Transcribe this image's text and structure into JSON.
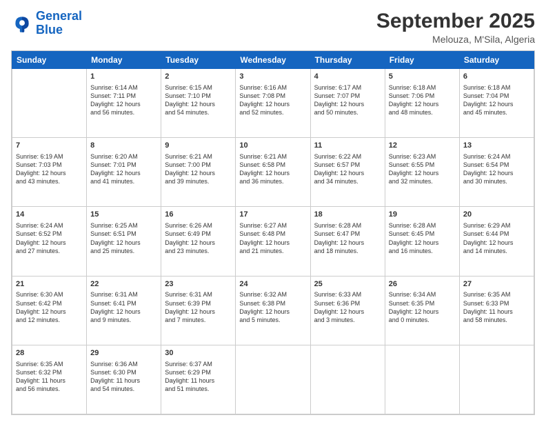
{
  "logo": {
    "text_general": "General",
    "text_blue": "Blue"
  },
  "header": {
    "month": "September 2025",
    "location": "Melouza, M'Sila, Algeria"
  },
  "days_of_week": [
    "Sunday",
    "Monday",
    "Tuesday",
    "Wednesday",
    "Thursday",
    "Friday",
    "Saturday"
  ],
  "weeks": [
    [
      {
        "day": "",
        "info": ""
      },
      {
        "day": "1",
        "info": "Sunrise: 6:14 AM\nSunset: 7:11 PM\nDaylight: 12 hours\nand 56 minutes."
      },
      {
        "day": "2",
        "info": "Sunrise: 6:15 AM\nSunset: 7:10 PM\nDaylight: 12 hours\nand 54 minutes."
      },
      {
        "day": "3",
        "info": "Sunrise: 6:16 AM\nSunset: 7:08 PM\nDaylight: 12 hours\nand 52 minutes."
      },
      {
        "day": "4",
        "info": "Sunrise: 6:17 AM\nSunset: 7:07 PM\nDaylight: 12 hours\nand 50 minutes."
      },
      {
        "day": "5",
        "info": "Sunrise: 6:18 AM\nSunset: 7:06 PM\nDaylight: 12 hours\nand 48 minutes."
      },
      {
        "day": "6",
        "info": "Sunrise: 6:18 AM\nSunset: 7:04 PM\nDaylight: 12 hours\nand 45 minutes."
      }
    ],
    [
      {
        "day": "7",
        "info": "Sunrise: 6:19 AM\nSunset: 7:03 PM\nDaylight: 12 hours\nand 43 minutes."
      },
      {
        "day": "8",
        "info": "Sunrise: 6:20 AM\nSunset: 7:01 PM\nDaylight: 12 hours\nand 41 minutes."
      },
      {
        "day": "9",
        "info": "Sunrise: 6:21 AM\nSunset: 7:00 PM\nDaylight: 12 hours\nand 39 minutes."
      },
      {
        "day": "10",
        "info": "Sunrise: 6:21 AM\nSunset: 6:58 PM\nDaylight: 12 hours\nand 36 minutes."
      },
      {
        "day": "11",
        "info": "Sunrise: 6:22 AM\nSunset: 6:57 PM\nDaylight: 12 hours\nand 34 minutes."
      },
      {
        "day": "12",
        "info": "Sunrise: 6:23 AM\nSunset: 6:55 PM\nDaylight: 12 hours\nand 32 minutes."
      },
      {
        "day": "13",
        "info": "Sunrise: 6:24 AM\nSunset: 6:54 PM\nDaylight: 12 hours\nand 30 minutes."
      }
    ],
    [
      {
        "day": "14",
        "info": "Sunrise: 6:24 AM\nSunset: 6:52 PM\nDaylight: 12 hours\nand 27 minutes."
      },
      {
        "day": "15",
        "info": "Sunrise: 6:25 AM\nSunset: 6:51 PM\nDaylight: 12 hours\nand 25 minutes."
      },
      {
        "day": "16",
        "info": "Sunrise: 6:26 AM\nSunset: 6:49 PM\nDaylight: 12 hours\nand 23 minutes."
      },
      {
        "day": "17",
        "info": "Sunrise: 6:27 AM\nSunset: 6:48 PM\nDaylight: 12 hours\nand 21 minutes."
      },
      {
        "day": "18",
        "info": "Sunrise: 6:28 AM\nSunset: 6:47 PM\nDaylight: 12 hours\nand 18 minutes."
      },
      {
        "day": "19",
        "info": "Sunrise: 6:28 AM\nSunset: 6:45 PM\nDaylight: 12 hours\nand 16 minutes."
      },
      {
        "day": "20",
        "info": "Sunrise: 6:29 AM\nSunset: 6:44 PM\nDaylight: 12 hours\nand 14 minutes."
      }
    ],
    [
      {
        "day": "21",
        "info": "Sunrise: 6:30 AM\nSunset: 6:42 PM\nDaylight: 12 hours\nand 12 minutes."
      },
      {
        "day": "22",
        "info": "Sunrise: 6:31 AM\nSunset: 6:41 PM\nDaylight: 12 hours\nand 9 minutes."
      },
      {
        "day": "23",
        "info": "Sunrise: 6:31 AM\nSunset: 6:39 PM\nDaylight: 12 hours\nand 7 minutes."
      },
      {
        "day": "24",
        "info": "Sunrise: 6:32 AM\nSunset: 6:38 PM\nDaylight: 12 hours\nand 5 minutes."
      },
      {
        "day": "25",
        "info": "Sunrise: 6:33 AM\nSunset: 6:36 PM\nDaylight: 12 hours\nand 3 minutes."
      },
      {
        "day": "26",
        "info": "Sunrise: 6:34 AM\nSunset: 6:35 PM\nDaylight: 12 hours\nand 0 minutes."
      },
      {
        "day": "27",
        "info": "Sunrise: 6:35 AM\nSunset: 6:33 PM\nDaylight: 11 hours\nand 58 minutes."
      }
    ],
    [
      {
        "day": "28",
        "info": "Sunrise: 6:35 AM\nSunset: 6:32 PM\nDaylight: 11 hours\nand 56 minutes."
      },
      {
        "day": "29",
        "info": "Sunrise: 6:36 AM\nSunset: 6:30 PM\nDaylight: 11 hours\nand 54 minutes."
      },
      {
        "day": "30",
        "info": "Sunrise: 6:37 AM\nSunset: 6:29 PM\nDaylight: 11 hours\nand 51 minutes."
      },
      {
        "day": "",
        "info": ""
      },
      {
        "day": "",
        "info": ""
      },
      {
        "day": "",
        "info": ""
      },
      {
        "day": "",
        "info": ""
      }
    ]
  ]
}
